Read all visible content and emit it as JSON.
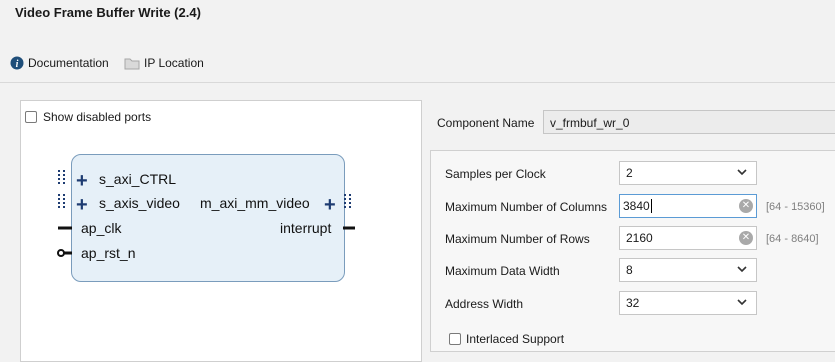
{
  "window": {
    "title": "Video Frame Buffer Write (2.4)"
  },
  "toolbar": {
    "documentation": "Documentation",
    "ip_location": "IP Location"
  },
  "left": {
    "show_disabled_ports": "Show disabled ports",
    "ports": {
      "s_axi_ctrl": "s_axi_CTRL",
      "s_axis_video": "s_axis_video",
      "ap_clk": "ap_clk",
      "ap_rst_n": "ap_rst_n",
      "m_axi_mm_video": "m_axi_mm_video",
      "interrupt": "interrupt"
    }
  },
  "component": {
    "label": "Component Name",
    "value": "v_frmbuf_wr_0"
  },
  "params": {
    "samples_per_clock": {
      "label": "Samples per Clock",
      "value": "2"
    },
    "max_columns": {
      "label": "Maximum Number of Columns",
      "value": "3840",
      "range": "[64 - 15360]"
    },
    "max_rows": {
      "label": "Maximum Number of Rows",
      "value": "2160",
      "range": "[64 - 8640]"
    },
    "max_data_width": {
      "label": "Maximum Data Width",
      "value": "8"
    },
    "address_width": {
      "label": "Address Width",
      "value": "32"
    },
    "interlaced": {
      "label": "Interlaced Support"
    }
  }
}
